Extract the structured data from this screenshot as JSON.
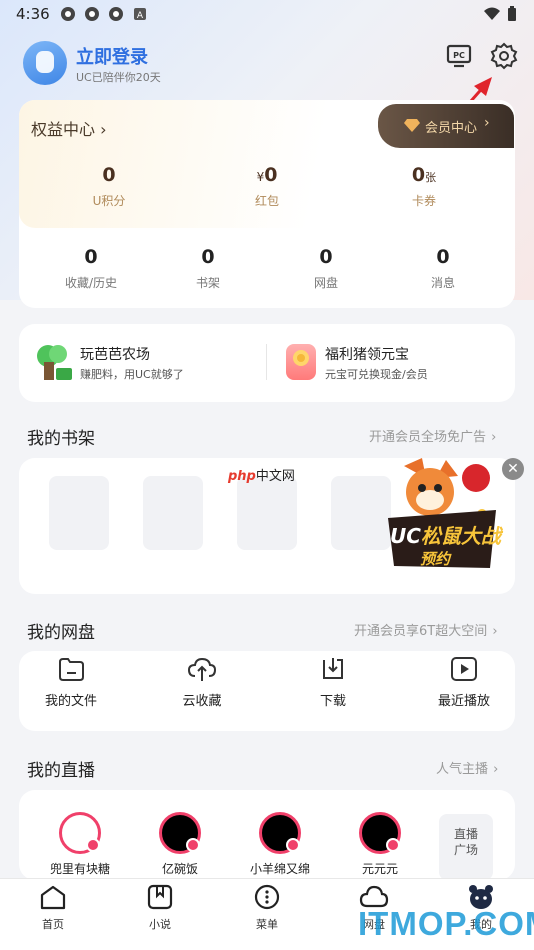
{
  "status": {
    "time": "4:36"
  },
  "header": {
    "login": "立即登录",
    "subtitle": "UC已陪伴你20天"
  },
  "benefits": {
    "title": "权益中心",
    "vip_button": "会员中心",
    "items": [
      {
        "value": "0",
        "prefix": "",
        "suffix": "",
        "label": "U积分"
      },
      {
        "value": "0",
        "prefix": "¥",
        "suffix": "",
        "label": "红包"
      },
      {
        "value": "0",
        "prefix": "",
        "suffix": "张",
        "label": "卡券"
      }
    ]
  },
  "stats": [
    {
      "value": "0",
      "label": "收藏/历史"
    },
    {
      "value": "0",
      "label": "书架"
    },
    {
      "value": "0",
      "label": "网盘"
    },
    {
      "value": "0",
      "label": "消息"
    }
  ],
  "promos": [
    {
      "title": "玩芭芭农场",
      "desc": "赚肥料，用UC就够了"
    },
    {
      "title": "福利猪领元宝",
      "desc": "元宝可兑换现金/会员"
    }
  ],
  "bookshelf": {
    "title": "我的书架",
    "link": "开通会员全场免广告"
  },
  "ad": {
    "watermark": "中文网",
    "line1": "松鼠大战",
    "line2": "预约"
  },
  "disk": {
    "title": "我的网盘",
    "link": "开通会员享6T超大空间",
    "items": [
      {
        "label": "我的文件",
        "icon": "folder-icon"
      },
      {
        "label": "云收藏",
        "icon": "cloud-upload-icon"
      },
      {
        "label": "下载",
        "icon": "download-icon"
      },
      {
        "label": "最近播放",
        "icon": "play-icon"
      }
    ]
  },
  "live": {
    "title": "我的直播",
    "link": "人气主播",
    "hosts": [
      "兜里有块糖",
      "亿碗饭",
      "小羊绵又绵",
      "元元元"
    ],
    "square": "直播广场"
  },
  "tabbar": [
    {
      "label": "首页",
      "icon": "home-icon"
    },
    {
      "label": "小说",
      "icon": "book-icon"
    },
    {
      "label": "菜单",
      "icon": "menu-icon"
    },
    {
      "label": "网盘",
      "icon": "cloud-icon"
    },
    {
      "label": "我的",
      "icon": "profile-icon"
    }
  ],
  "watermark": "ITMOP.COM"
}
